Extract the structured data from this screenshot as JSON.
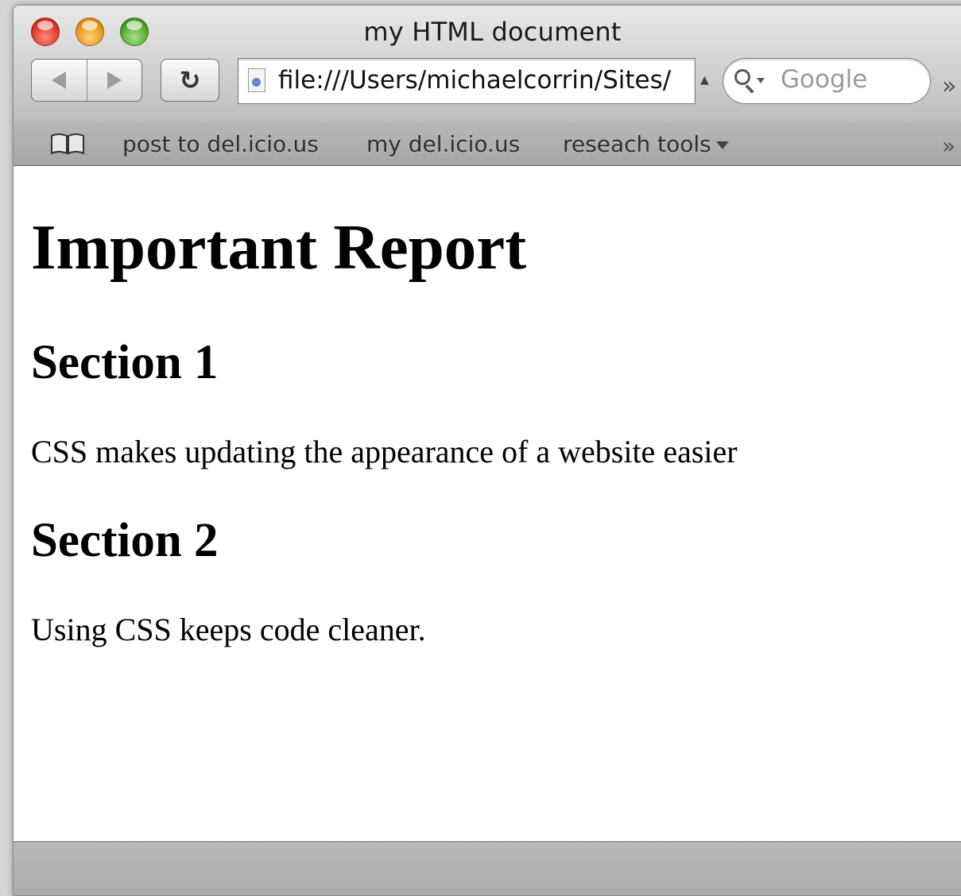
{
  "window": {
    "title": "my HTML document"
  },
  "toolbar": {
    "back_icon": "back-arrow-icon",
    "forward_icon": "forward-arrow-icon",
    "reload_glyph": "↻",
    "address": "file:///Users/michaelcorrin/Sites/",
    "search_placeholder": "Google",
    "overflow_glyph": "»"
  },
  "bookmarks": {
    "items": [
      {
        "label": "post to del.icio.us"
      },
      {
        "label": "my del.icio.us"
      },
      {
        "label": "reseach tools"
      }
    ],
    "overflow_glyph": "»"
  },
  "page": {
    "heading": "Important Report",
    "sections": [
      {
        "title": "Section 1",
        "text": "CSS makes updating the appearance of a website easier"
      },
      {
        "title": "Section 2",
        "text": "Using CSS keeps code cleaner."
      }
    ]
  },
  "colors": {
    "close": "#d7281a",
    "minimize": "#e08a0c",
    "zoom": "#3e9b1e"
  }
}
